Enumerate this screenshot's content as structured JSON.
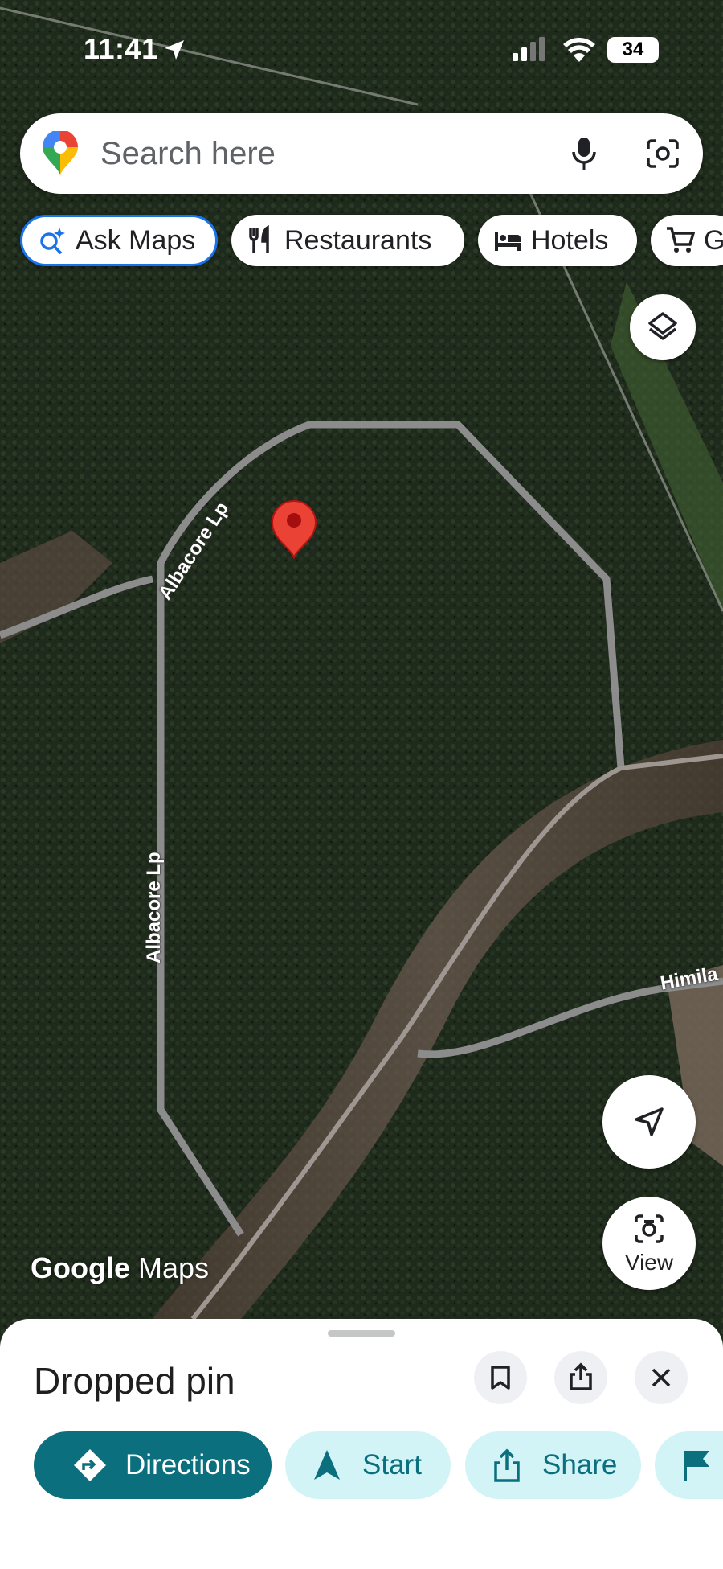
{
  "status_bar": {
    "time": "11:41",
    "battery": "34",
    "icons": [
      "location-arrow-icon",
      "cellular-signal-icon",
      "wifi-icon",
      "battery-icon"
    ]
  },
  "search": {
    "placeholder": "Search here",
    "icons": [
      "google-maps-pin-icon",
      "microphone-icon",
      "google-lens-icon"
    ]
  },
  "chips": [
    {
      "label": "Ask Maps",
      "icon": "ask-maps-sparkle-icon"
    },
    {
      "label": "Restaurants",
      "icon": "fork-knife-icon"
    },
    {
      "label": "Hotels",
      "icon": "bed-icon"
    },
    {
      "label": "G",
      "icon": "shopping-cart-icon"
    }
  ],
  "map": {
    "type": "satellite",
    "road_labels": [
      "Albacore Lp",
      "Albacore Lp",
      "Himila"
    ],
    "pin": "red-map-pin",
    "watermark_google": "Google",
    "watermark_maps": "Maps"
  },
  "map_controls": {
    "layers_icon": "layers-icon",
    "location_icon": "navigation-arrow-icon",
    "view_label": "View",
    "view_icon": "camera-icon"
  },
  "sheet": {
    "title": "Dropped pin",
    "icons": [
      "bookmark-icon",
      "share-icon",
      "close-icon"
    ],
    "actions": [
      {
        "label": "Directions",
        "icon": "directions-icon"
      },
      {
        "label": "Start",
        "icon": "navigation-arrow-icon"
      },
      {
        "label": "Share",
        "icon": "share-icon"
      },
      {
        "label": "",
        "icon": "flag-icon"
      }
    ]
  },
  "colors": {
    "accent": "#0b6f7d",
    "chip_active_border": "#1a73e8",
    "secondary_button": "#d3f4f7",
    "pin": "#ea4335",
    "road": "#9a9a9a"
  }
}
